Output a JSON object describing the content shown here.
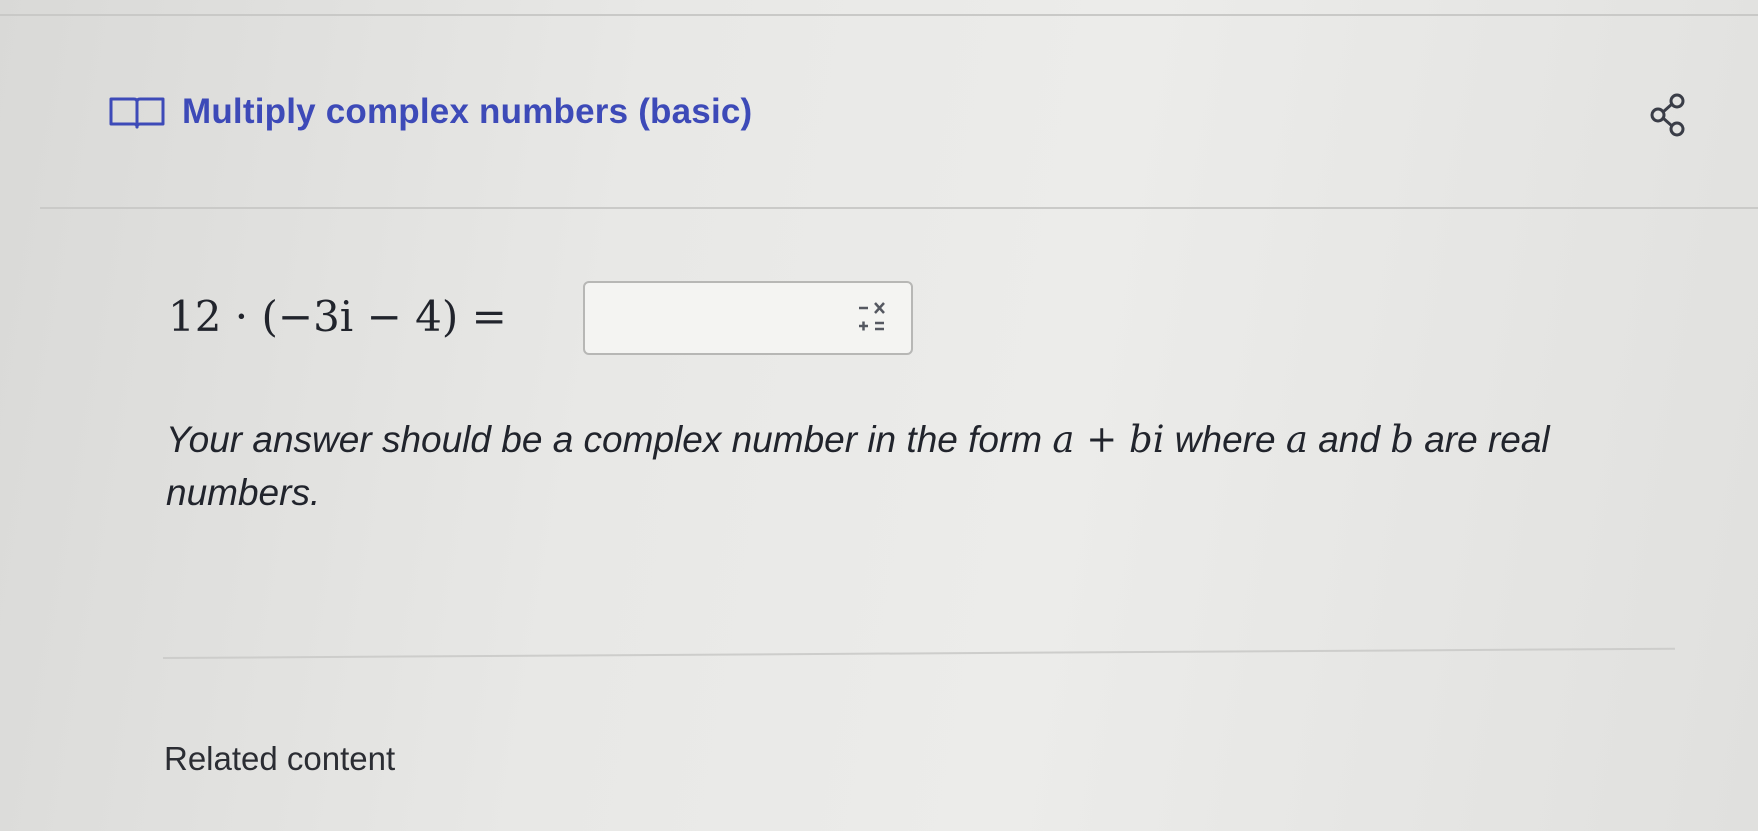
{
  "exercise": {
    "title": "Multiply complex numbers (basic)",
    "icons": {
      "title_icon": "book-icon",
      "share_icon": "share-icon",
      "keypad_icon": "math-keypad-icon"
    },
    "accent_color": "#3d4ab8"
  },
  "problem": {
    "equation": "12 · (−3i − 4) =",
    "answer_value": "",
    "instructions": {
      "part1": "Your answer should be a complex number in the form ",
      "expr": "a + bi",
      "part2": " where ",
      "var_a": "a",
      "part3": " and ",
      "var_b": "b",
      "part4": " are real numbers."
    }
  },
  "footer": {
    "related_label": "Related content"
  }
}
